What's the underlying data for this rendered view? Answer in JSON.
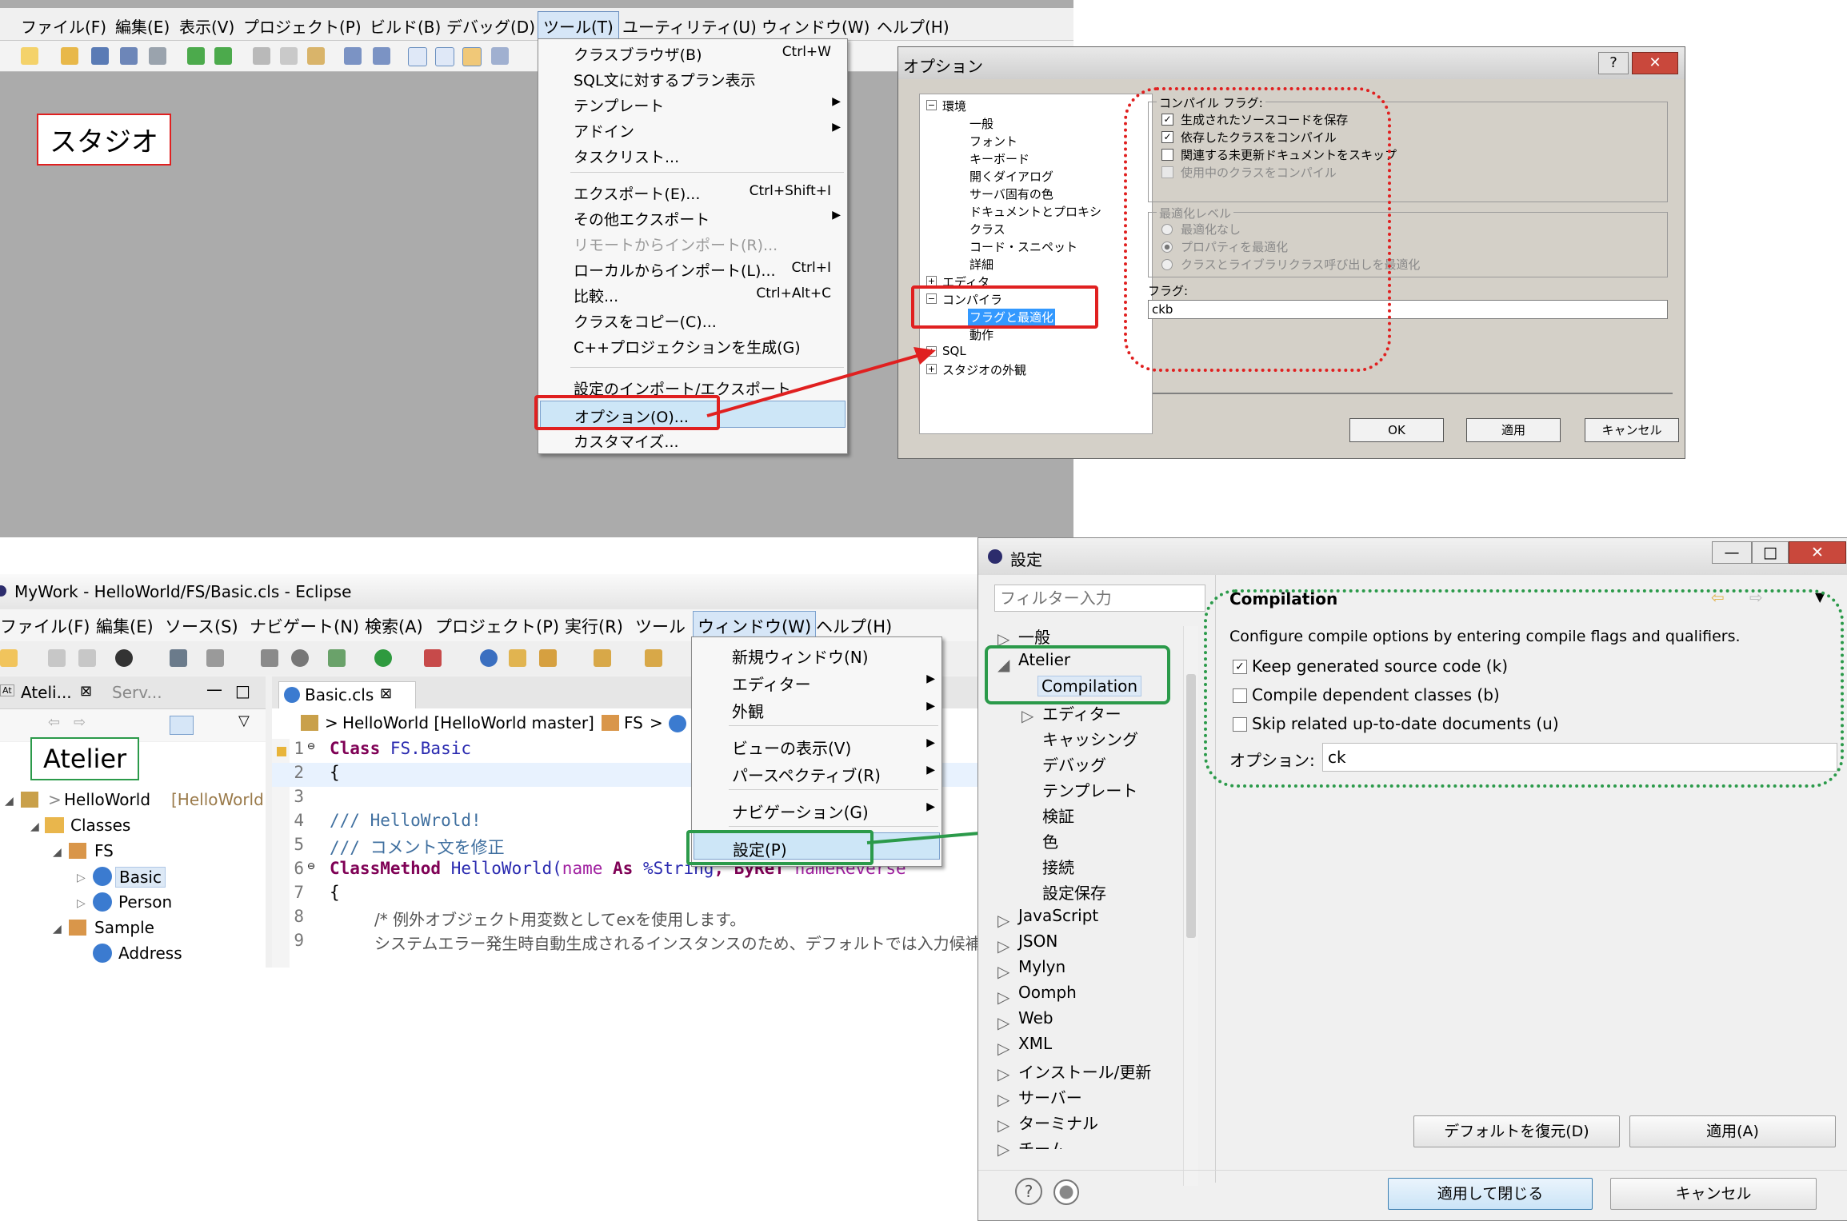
{
  "studio": {
    "menu": [
      "ファイル(F)",
      "編集(E)",
      "表示(V)",
      "プロジェクト(P)",
      "ビルド(B)",
      "デバッグ(D)",
      "ツール(T)",
      "ユーティリティ(U)",
      "ウィンドウ(W)",
      "ヘルプ(H)"
    ],
    "label": "スタジオ",
    "tools_menu": [
      {
        "label": "クラスブラウザ(B)",
        "shortcut": "Ctrl+W"
      },
      {
        "label": "SQL文に対するプラン表示",
        "shortcut": ""
      },
      {
        "label": "テンプレート",
        "shortcut": ""
      },
      {
        "label": "アドイン",
        "shortcut": ""
      },
      {
        "label": "タスクリスト...",
        "shortcut": ""
      },
      {
        "label": "エクスポート(E)...",
        "shortcut": "Ctrl+Shift+I"
      },
      {
        "label": "その他エクスポート",
        "shortcut": ""
      },
      {
        "label": "リモートからインポート(R)...",
        "shortcut": ""
      },
      {
        "label": "ローカルからインポート(L)...",
        "shortcut": "Ctrl+I"
      },
      {
        "label": "比較...",
        "shortcut": "Ctrl+Alt+C"
      },
      {
        "label": "クラスをコピー(C)...",
        "shortcut": ""
      },
      {
        "label": "C++プロジェクションを生成(G)",
        "shortcut": ""
      },
      {
        "label": "設定のインポート/エクスポート",
        "shortcut": ""
      },
      {
        "label": "オプション(O)...",
        "shortcut": ""
      },
      {
        "label": "カスタマイズ...",
        "shortcut": ""
      }
    ]
  },
  "options_dialog": {
    "title": "オプション",
    "tree": {
      "env": "環境",
      "env_children": [
        "一般",
        "フォント",
        "キーボード",
        "開くダイアログ",
        "サーバ固有の色",
        "ドキュメントとプロキシ",
        "クラス",
        "コード・スニペット",
        "詳細"
      ],
      "editor": "エディタ",
      "compiler": "コンパイラ",
      "flags": "フラグと最適化",
      "behavior": "動作",
      "sql": "SQL",
      "studio_look": "スタジオの外観"
    },
    "compile_group": "コンパイル フラグ:",
    "compile_flags": [
      "生成されたソースコードを保存",
      "依存したクラスをコンパイル",
      "関連する未更新ドキュメントをスキップ",
      "使用中のクラスをコンパイル"
    ],
    "opt_group": "最適化レベル",
    "opt_levels": [
      "最適化なし",
      "プロパティを最適化",
      "クラスとライブラリクラス呼び出しを最適化"
    ],
    "flags_label": "フラグ:",
    "flags_value": "ckb",
    "ok": "OK",
    "apply": "適用",
    "cancel": "キャンセル"
  },
  "eclipse": {
    "title": "MyWork - HelloWorld/FS/Basic.cls - Eclipse",
    "menu": [
      "ファイル(F)",
      "編集(E)",
      "ソース(S)",
      "ナビゲート(N)",
      "検索(A)",
      "プロジェクト(P)",
      "実行(R)",
      "ツール",
      "ウィンドウ(W)",
      "ヘルプ(H)"
    ],
    "tab_atelier": "Ateli...",
    "tab_serv": "Serv...",
    "label": "Atelier",
    "tree": {
      "project": "HelloWorld",
      "project_suffix": "[HelloWorld mas",
      "classes": "Classes",
      "fs": "FS",
      "basic": "Basic",
      "person": "Person",
      "sample": "Sample",
      "address": "Address"
    },
    "editor_tab": "Basic.cls",
    "breadcrumb": [
      "HelloWorld [HelloWorld master]",
      "FS"
    ],
    "window_menu": [
      "新規ウィンドウ(N)",
      "エディター",
      "外観",
      "ビューの表示(V)",
      "パースペクティブ(R)",
      "ナビゲーション(G)",
      "設定(P)"
    ],
    "code": {
      "l1_kw": "Class",
      "l1_name": " FS.Basic",
      "l2": "{",
      "l4": "/// HelloWrold!",
      "l5": "/// コメント文を修正",
      "l6_kw": "ClassMethod",
      "l6_name": " HelloWorld(",
      "l6_p1": "name",
      "l6_as": " As ",
      "l6_type": "%String",
      "l6_byref": ", ByRef ",
      "l6_p2": "nameReverse",
      "l7": "{",
      "l8": "/*  例外オブジェクト用変数としてexを使用します。",
      "l9": "システムエラー発生時自動生成されるインスタンスのため、デフォルトでは入力候補が"
    }
  },
  "prefs": {
    "title": "設定",
    "filter_placeholder": "フィルター入力",
    "tree": [
      "一般",
      "Atelier",
      "Compilation",
      "エディター",
      "キャッシング",
      "デバッグ",
      "テンプレート",
      "検証",
      "色",
      "接続",
      "設定保存",
      "JavaScript",
      "JSON",
      "Mylyn",
      "Oomph",
      "Web",
      "XML",
      "インストール/更新",
      "サーバー",
      "ターミナル",
      "チーム"
    ],
    "page_title": "Compilation",
    "description": "Configure compile options by entering compile flags and qualifiers.",
    "checks": [
      {
        "label": "Keep generated source code (k)",
        "checked": true
      },
      {
        "label": "Compile dependent classes (b)",
        "checked": false
      },
      {
        "label": "Skip related up-to-date documents (u)",
        "checked": false
      }
    ],
    "option_label": "オプション:",
    "option_value": "ck",
    "restore": "デフォルトを復元(D)",
    "apply": "適用(A)",
    "apply_close": "適用して閉じる",
    "cancel": "キャンセル"
  },
  "colors": {
    "red": "#e02020",
    "green": "#2b9a4a",
    "selection": "#3399ff",
    "menu_hl": "#cde6f7"
  }
}
